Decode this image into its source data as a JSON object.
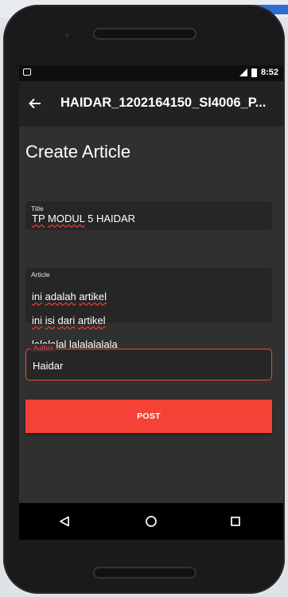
{
  "status_bar": {
    "time": "8:52"
  },
  "app_bar": {
    "title": "HAIDAR_1202164150_SI4006_P..."
  },
  "page": {
    "heading": "Create Article"
  },
  "form": {
    "title": {
      "label": "Title",
      "value_parts": [
        "TP",
        " ",
        "MODUL",
        " 5 HAIDAR"
      ]
    },
    "article": {
      "label": "Article",
      "lines": [
        [
          "ini",
          " ",
          "adalah",
          " ",
          "artikel"
        ],
        [
          "ini",
          " ",
          "isi",
          " ",
          "dari",
          " ",
          "artikel"
        ],
        [
          "lalalalal",
          " lalalalalala"
        ]
      ]
    },
    "author": {
      "label": "Author",
      "value": "Haidar"
    },
    "post_label": "POST"
  },
  "colors": {
    "accent": "#f44336",
    "background": "#303030",
    "appbar": "#222222"
  },
  "icons": [
    "back-arrow-icon",
    "nav-back-icon",
    "nav-home-icon",
    "nav-recents-icon"
  ]
}
